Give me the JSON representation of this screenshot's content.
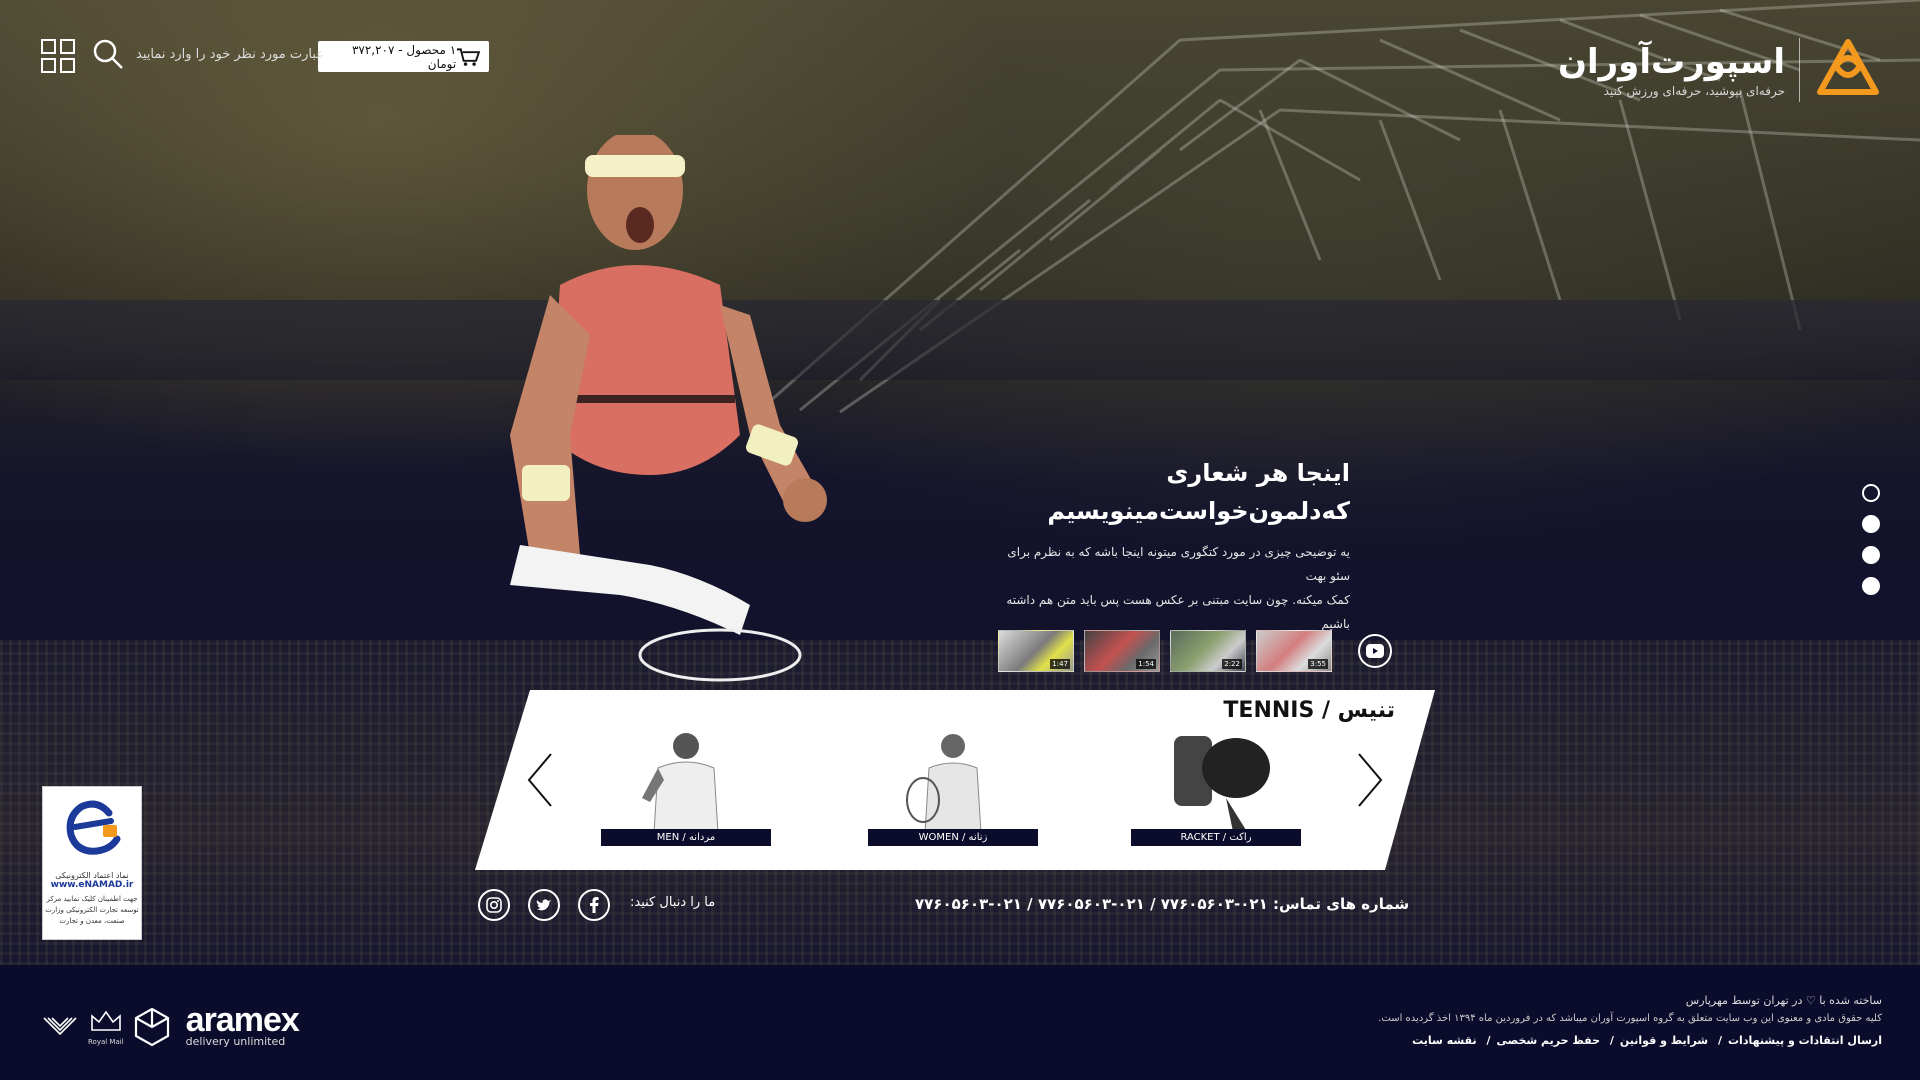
{
  "header": {
    "logo_title": "اسپورت‌آوران",
    "logo_tagline": "حرفه‌ای بپوشید، حرفه‌ای ورزش کنید",
    "cart_text": "۱ محصول - ۳۷۲,۲۰۷ تومان",
    "search_placeholder": "عبارت مورد نظر خود را وارد نمایید"
  },
  "hero": {
    "slogan_line1": "اینجا هر شعاری",
    "slogan_line2": "که‌دلمون‌خواست‌مینویسیم",
    "description_line1": "یه توضیحی چیزی در مورد کتگوری میتونه اینجا باشه که به نظرم برای سئو بهت",
    "description_line2": "کمک میکنه. چون سایت مبتنی بر عکس هست پس باید متن هم داشته باشیم",
    "slides_count": 4,
    "active_slide": 1
  },
  "videos": [
    {
      "duration": "1:47"
    },
    {
      "duration": "1:54"
    },
    {
      "duration": "2:22"
    },
    {
      "duration": "3:55"
    }
  ],
  "category_panel": {
    "title": "تنیس / TENNIS",
    "items": [
      {
        "label": "مردانه / MEN"
      },
      {
        "label": "زنانه / WOMEN"
      },
      {
        "label": "راکت / RACKET"
      }
    ]
  },
  "contact": {
    "phones": "شماره های تماس: ۰۲۱-۷۷۶۰۵۶۰۳ / ۰۲۱-۷۷۶۰۵۶۰۳ / ۰۲۱-۷۷۶۰۵۶۰۳",
    "follow_label": "ما را دنبال کنید:"
  },
  "enamad": {
    "site": "www.eNAMAD.ir",
    "title": "نماد اعتماد الکترونیکی",
    "text": "جهت اطمینان کلیک نمایید مرکز توسعه تجارت الکترونیکی وزارت صنعت، معدن و تجارت"
  },
  "footer": {
    "made_by": "ساخته شده با ♡ در تهران توسط مهرپارس",
    "rights": "کلیه حقوق مادی و معنوی این وب سایت متعلق به گروه اسپورت آوران میباشد که در فروردین ماه ۱۳۹۴ اخذ گردیده است.",
    "links": [
      "ارسال انتقادات و پیشنهادات",
      "شرایط و قوانین",
      "حفظ حریم شخصی",
      "نقشه سایت"
    ],
    "aramex_name": "aramex",
    "aramex_tagline": "delivery unlimited",
    "royal_mail": "Royal Mail"
  },
  "colors": {
    "background": "#0b0b2b",
    "accent": "#f39a1e",
    "panel": "#ffffff"
  }
}
